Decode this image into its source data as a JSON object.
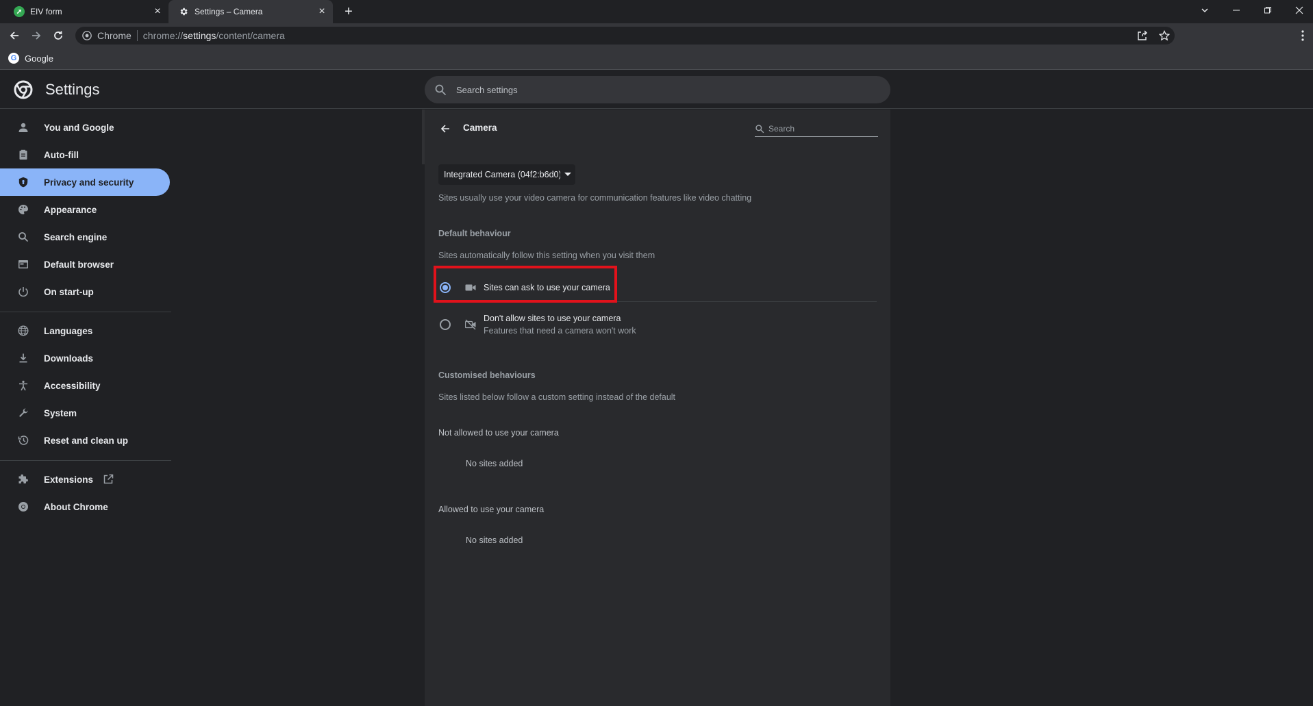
{
  "tabs": [
    {
      "title": "EIV form"
    },
    {
      "title": "Settings – Camera"
    }
  ],
  "omnibox": {
    "site_label": "Chrome",
    "url_prefix": "chrome://",
    "url_host": "settings",
    "url_path": "/content/camera"
  },
  "bookmarks": [
    {
      "label": "Google"
    }
  ],
  "settings_header": {
    "title": "Settings",
    "search_placeholder": "Search settings"
  },
  "sidebar": {
    "items": [
      {
        "label": "You and Google",
        "icon": "person-icon"
      },
      {
        "label": "Auto-fill",
        "icon": "clipboard-icon"
      },
      {
        "label": "Privacy and security",
        "icon": "shield-icon",
        "active": true
      },
      {
        "label": "Appearance",
        "icon": "palette-icon"
      },
      {
        "label": "Search engine",
        "icon": "search-icon"
      },
      {
        "label": "Default browser",
        "icon": "browser-icon"
      },
      {
        "label": "On start-up",
        "icon": "power-icon"
      },
      {
        "label": "Languages",
        "icon": "globe-icon"
      },
      {
        "label": "Downloads",
        "icon": "download-icon"
      },
      {
        "label": "Accessibility",
        "icon": "accessibility-icon"
      },
      {
        "label": "System",
        "icon": "wrench-icon"
      },
      {
        "label": "Reset and clean up",
        "icon": "history-icon"
      },
      {
        "label": "Extensions",
        "icon": "puzzle-icon"
      },
      {
        "label": "About Chrome",
        "icon": "chrome-icon"
      }
    ]
  },
  "camera_page": {
    "title": "Camera",
    "search_placeholder": "Search",
    "camera_select_value": "Integrated Camera (04f2:b6d0)",
    "description": "Sites usually use your video camera for communication features like video chatting",
    "default_heading": "Default behaviour",
    "default_description": "Sites automatically follow this setting when you visit them",
    "option_allow": "Sites can ask to use your camera",
    "option_block": "Don't allow sites to use your camera",
    "option_block_sub": "Features that need a camera won't work",
    "custom_heading": "Customised behaviours",
    "custom_description": "Sites listed below follow a custom setting instead of the default",
    "not_allowed_heading": "Not allowed to use your camera",
    "not_allowed_empty": "No sites added",
    "allowed_heading": "Allowed to use your camera",
    "allowed_empty": "No sites added",
    "selected_option": "allow"
  },
  "colors": {
    "accent": "#8ab4f8",
    "highlight_box": "#e1121b",
    "background": "#202124",
    "card": "#292a2d"
  }
}
